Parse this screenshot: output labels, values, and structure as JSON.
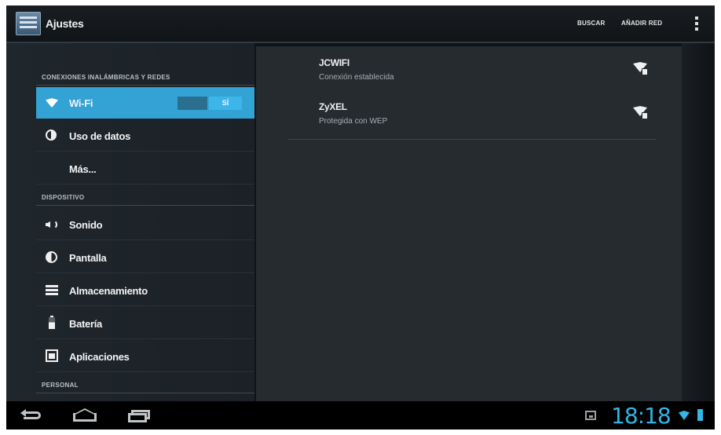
{
  "actionbar": {
    "title": "Ajustes",
    "search_label": "BUSCAR",
    "add_network_label": "AÑADIR RED"
  },
  "sidebar": {
    "sections": [
      {
        "header": "CONEXIONES INALÁMBRICAS Y REDES"
      },
      {
        "header": "DISPOSITIVO"
      },
      {
        "header": "PERSONAL"
      }
    ],
    "items": [
      {
        "label": "Wi-Fi",
        "icon": "wifi-icon",
        "selected": true,
        "toggle_state": "SÍ"
      },
      {
        "label": "Uso de datos",
        "icon": "data-usage-icon"
      },
      {
        "label": "Más..."
      },
      {
        "label": "Sonido",
        "icon": "speaker-icon"
      },
      {
        "label": "Pantalla",
        "icon": "brightness-icon"
      },
      {
        "label": "Almacenamiento",
        "icon": "storage-icon"
      },
      {
        "label": "Batería",
        "icon": "battery-icon"
      },
      {
        "label": "Aplicaciones",
        "icon": "apps-icon"
      }
    ]
  },
  "networks": [
    {
      "name": "JCWIFI",
      "status": "Conexión establecida",
      "icon": "wifi-signal-lock-icon"
    },
    {
      "name": "ZyXEL",
      "status": "Protegida con WEP",
      "icon": "wifi-signal-lock-icon"
    }
  ],
  "systembar": {
    "clock": "18:18"
  },
  "colors": {
    "accent": "#33b5e5",
    "selected_item": "#33a2d4",
    "background": "#101316"
  }
}
